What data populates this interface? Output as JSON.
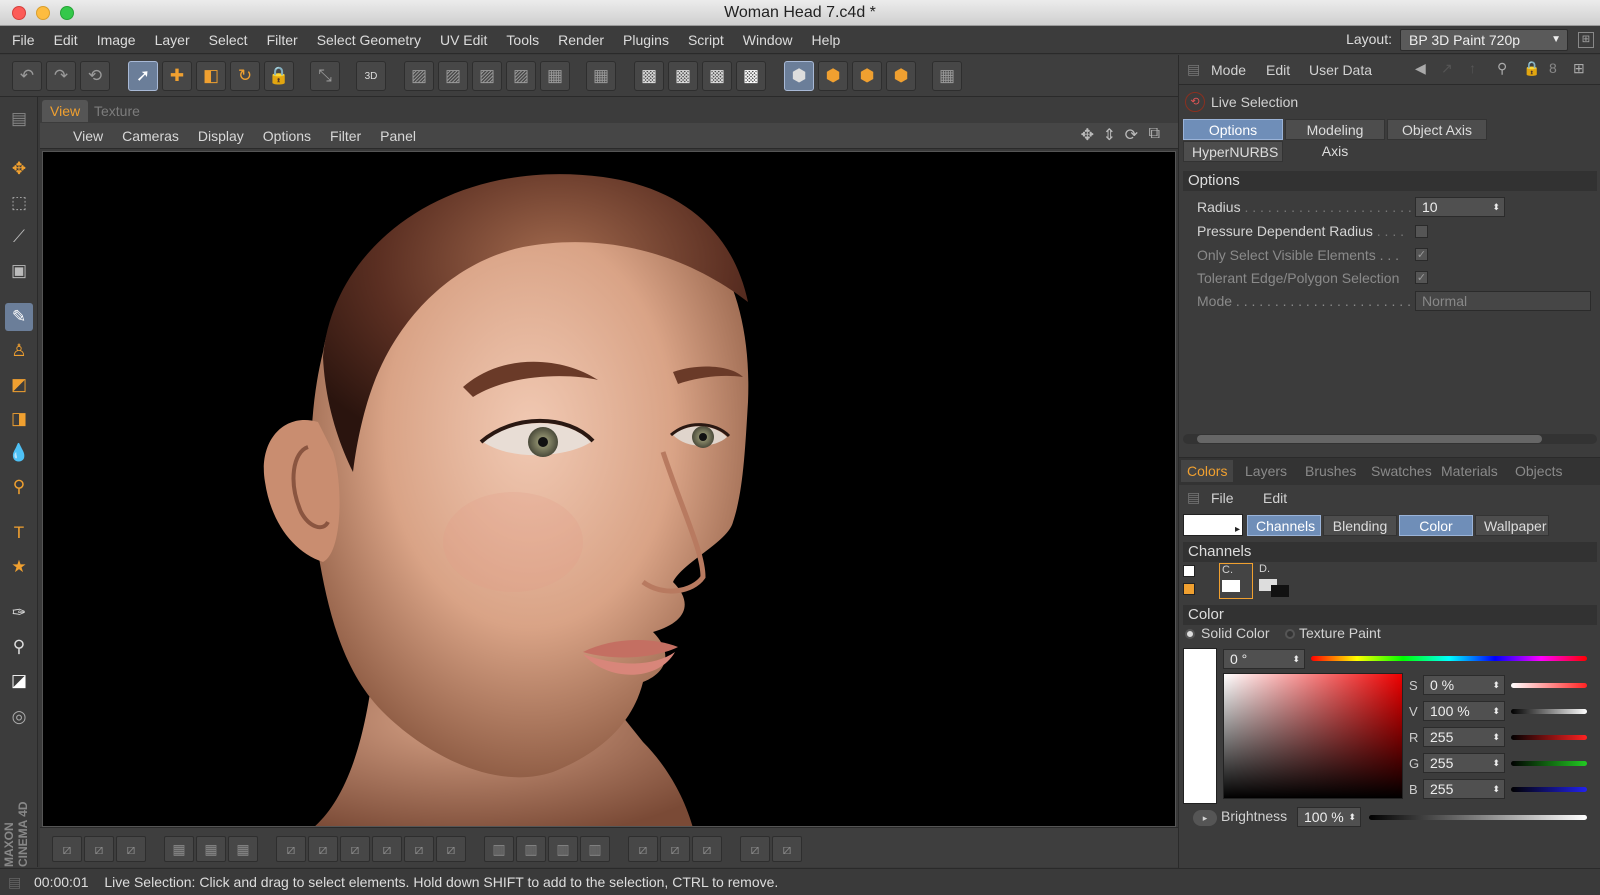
{
  "window": {
    "title": "Woman Head 7.c4d *"
  },
  "menubar": {
    "items": [
      "File",
      "Edit",
      "Image",
      "Layer",
      "Select",
      "Filter",
      "Select Geometry",
      "UV Edit",
      "Tools",
      "Render",
      "Plugins",
      "Script",
      "Window",
      "Help"
    ],
    "layout_label": "Layout:",
    "layout_value": "BP 3D Paint 720p"
  },
  "toolbar": {
    "badge_3d": "3D"
  },
  "viewport": {
    "tabs": [
      "View",
      "Texture"
    ],
    "menu": [
      "View",
      "Cameras",
      "Display",
      "Options",
      "Filter",
      "Panel"
    ]
  },
  "attributes": {
    "menu": [
      "Mode",
      "Edit",
      "User Data"
    ],
    "tool_name": "Live Selection",
    "tabs": [
      "Options",
      "Modeling Axis",
      "Object Axis",
      "HyperNURBS"
    ],
    "section": "Options",
    "radius_label": "Radius",
    "radius_value": "10",
    "pressure_label": "Pressure Dependent Radius",
    "visible_label": "Only Select Visible Elements",
    "tolerant_label": "Tolerant Edge/Polygon Selection",
    "mode_label": "Mode",
    "mode_value": "Normal"
  },
  "colors_panel": {
    "tabs": [
      "Colors",
      "Layers",
      "Brushes",
      "Swatches",
      "Materials",
      "Objects"
    ],
    "menu": [
      "File",
      "Edit"
    ],
    "buttons": [
      "Channels",
      "Blending",
      "Color",
      "Wallpaper"
    ],
    "channels_title": "Channels",
    "channel_c": "C.",
    "channel_d": "D.",
    "color_title": "Color",
    "solid_label": "Solid Color",
    "texture_label": "Texture Paint",
    "hue_value": "0 °",
    "s_label": "S",
    "s_value": "0 %",
    "v_label": "V",
    "v_value": "100 %",
    "r_label": "R",
    "r_value": "255",
    "g_label": "G",
    "g_value": "255",
    "b_label": "B",
    "b_value": "255",
    "brightness_label": "Brightness",
    "brightness_value": "100 %"
  },
  "status": {
    "time": "00:00:01",
    "message": "Live Selection: Click and drag to select elements. Hold down SHIFT to add to the selection, CTRL to remove."
  },
  "brand": {
    "text": "MAXON CINEMA 4D"
  },
  "colors": {
    "accent": "#f0a030",
    "selected_tab": "#6f8eb8"
  }
}
